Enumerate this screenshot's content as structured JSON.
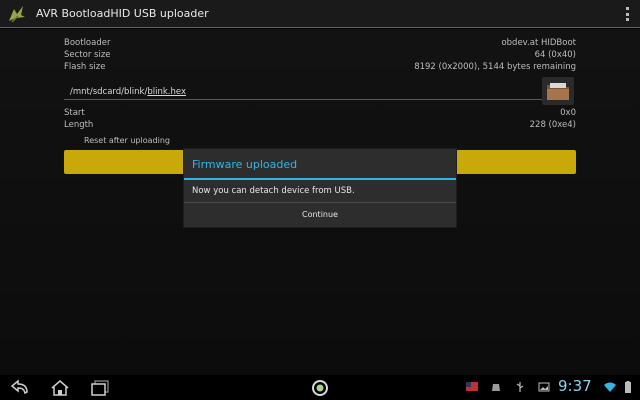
{
  "actionbar": {
    "title": "AVR BootloadHID USB uploader",
    "icon": "app-bird-icon"
  },
  "info": {
    "bootloader_label": "Bootloader",
    "bootloader_value": "obdev.at HIDBoot",
    "sector_label": "Sector size",
    "sector_value": "64 (0x40)",
    "flash_label": "Flash size",
    "flash_value": "8192 (0x2000), 5144 bytes remaining"
  },
  "file": {
    "path_prefix": "/mnt/sdcard/blink/",
    "path_file": "blink.hex",
    "icon": "folder-icon"
  },
  "range": {
    "start_label": "Start",
    "start_value": "0x0",
    "length_label": "Length",
    "length_value": "228 (0xe4)"
  },
  "options": {
    "reset_label": "Reset after uploading"
  },
  "dialog": {
    "title": "Firmware uploaded",
    "message": "Now you can detach device from USB.",
    "button": "Continue"
  },
  "sysbar": {
    "clock": "9:37",
    "colors": {
      "accent": "#33b5e5",
      "clock": "#8fd0ee",
      "upload_button": "#c9a90a"
    }
  }
}
